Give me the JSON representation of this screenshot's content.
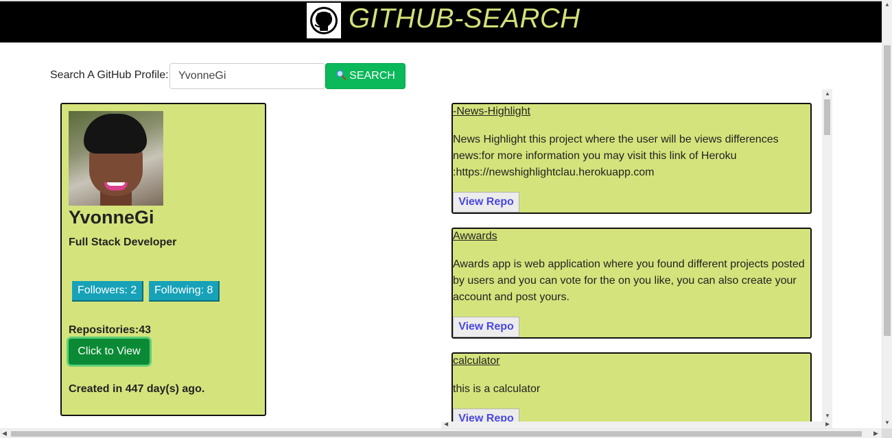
{
  "header": {
    "title": "GITHUB-SEARCH",
    "logo_icon": "github-octocat-icon"
  },
  "search": {
    "label": "Search A GitHub Profile:",
    "value": "YvonneGi",
    "button_label": "SEARCH",
    "button_icon": "magnifier-icon"
  },
  "profile": {
    "username": "YvonneGi",
    "bio": "Full Stack Developer",
    "followers_label": "Followers: 2",
    "following_label": "Following: 8",
    "repositories_label": "Repositories:43",
    "view_button": "Click to View",
    "created_label": "Created in 447 day(s) ago."
  },
  "repos": [
    {
      "name": "-News-Highlight",
      "description": "News Highlight this project where the user will be views differences news:for more information you may visit this link of Heroku :https://newshighlightclau.herokuapp.com",
      "button": "View Repo"
    },
    {
      "name": "Awwards",
      "description": "Awards app is web application where you found different projects posted by users and you can vote for the on you like, you can also create your account and post yours.",
      "button": "View Repo"
    },
    {
      "name": "calculator",
      "description": "this is a calculator",
      "button": "View Repo"
    }
  ],
  "colors": {
    "header_bg": "#000000",
    "title": "#d4e07a",
    "card_bg": "#d5e37c",
    "search_button": "#0bb85a",
    "pill": "#17a2b8",
    "view_button": "#0b8a35",
    "repo_button_text": "#4a47e0"
  }
}
